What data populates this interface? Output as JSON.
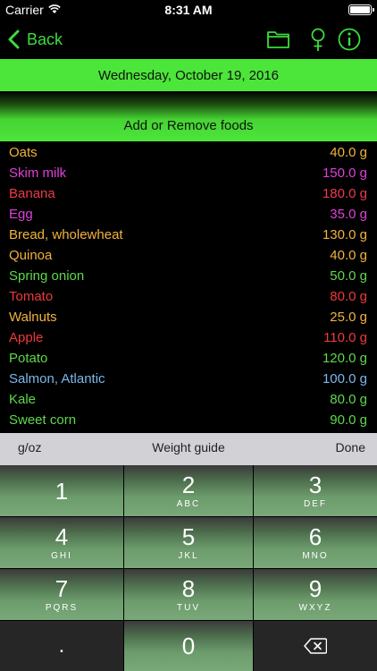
{
  "status_bar": {
    "carrier": "Carrier",
    "time": "8:31 AM"
  },
  "nav": {
    "back_label": "Back"
  },
  "date": "Wednesday, October 19, 2016",
  "add_remove_label": "Add or Remove foods",
  "foods": [
    {
      "name": "Oats",
      "amount": "40.0 g",
      "color": "#f2b33c"
    },
    {
      "name": "Skim milk",
      "amount": "150.0 g",
      "color": "#e040d8"
    },
    {
      "name": "Banana",
      "amount": "180.0 g",
      "color": "#ee3a4a"
    },
    {
      "name": "Egg",
      "amount": "35.0 g",
      "color": "#e040d8"
    },
    {
      "name": "Bread, wholewheat",
      "amount": "130.0 g",
      "color": "#f2b33c"
    },
    {
      "name": "Quinoa",
      "amount": "40.0 g",
      "color": "#f2b33c"
    },
    {
      "name": "Spring onion",
      "amount": "50.0 g",
      "color": "#5ed84a"
    },
    {
      "name": "Tomato",
      "amount": "80.0 g",
      "color": "#ee3a3a"
    },
    {
      "name": "Walnuts",
      "amount": "25.0 g",
      "color": "#f2b33c"
    },
    {
      "name": "Apple",
      "amount": "110.0 g",
      "color": "#ee3a3a"
    },
    {
      "name": "Potato",
      "amount": "120.0 g",
      "color": "#5ed84a"
    },
    {
      "name": "Salmon, Atlantic",
      "amount": "100.0 g",
      "color": "#7ab8ee"
    },
    {
      "name": "Kale",
      "amount": "80.0 g",
      "color": "#5ed84a"
    },
    {
      "name": "Sweet corn",
      "amount": "90.0 g",
      "color": "#5ed84a"
    }
  ],
  "keyboard_toolbar": {
    "unit_toggle": "g/oz",
    "weight_guide": "Weight guide",
    "done": "Done"
  },
  "keypad": {
    "keys": [
      {
        "digit": "1",
        "letters": ""
      },
      {
        "digit": "2",
        "letters": "ABC"
      },
      {
        "digit": "3",
        "letters": "DEF"
      },
      {
        "digit": "4",
        "letters": "GHI"
      },
      {
        "digit": "5",
        "letters": "JKL"
      },
      {
        "digit": "6",
        "letters": "MNO"
      },
      {
        "digit": "7",
        "letters": "PQRS"
      },
      {
        "digit": "8",
        "letters": "TUV"
      },
      {
        "digit": "9",
        "letters": "WXYZ"
      },
      {
        "digit": ".",
        "letters": ""
      },
      {
        "digit": "0",
        "letters": ""
      }
    ],
    "delete_icon": "backspace-icon"
  },
  "colors": {
    "accent_green": "#3cdc3c",
    "date_bar": "#4ce53a",
    "toolbar_bg": "#d2d2d6",
    "key_dark": "#262626"
  }
}
